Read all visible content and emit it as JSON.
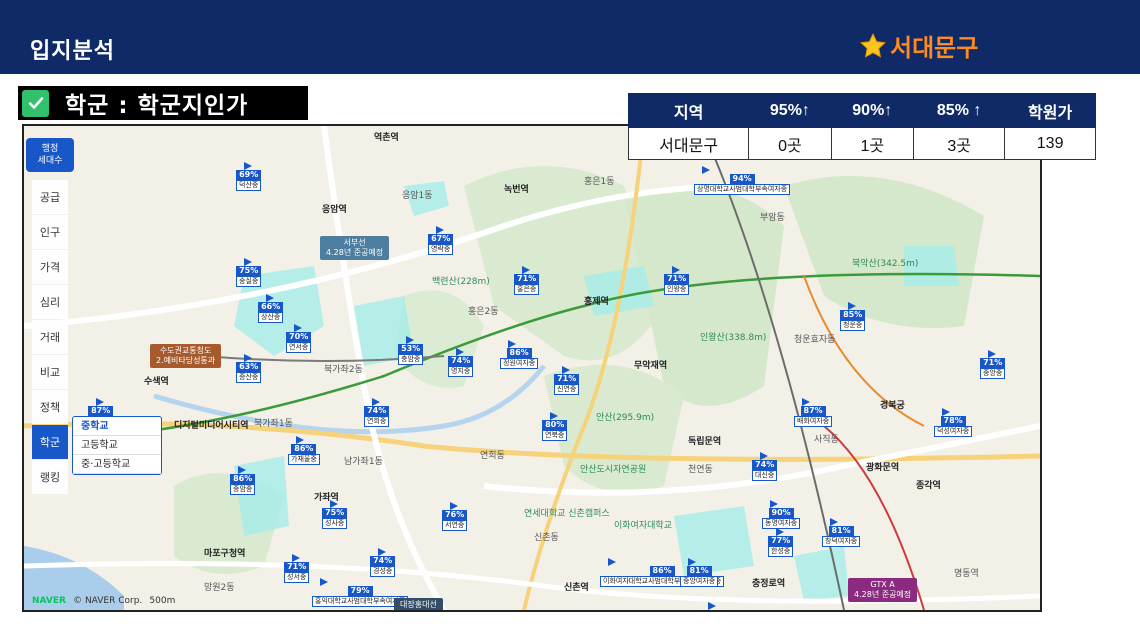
{
  "header": {
    "title": "입지분석",
    "region": "서대문구"
  },
  "section": {
    "label": "학군 : 학군지인가"
  },
  "table": {
    "headers": [
      "지역",
      "95%↑",
      "90%↑",
      "85% ↑",
      "학원가"
    ],
    "row": [
      "서대문구",
      "0곳",
      "1곳",
      "3곳",
      "139"
    ]
  },
  "side_nav": {
    "top_line1": "행정",
    "top_line2": "세대수",
    "items": [
      "공급",
      "인구",
      "가격",
      "심리",
      "거래",
      "비교",
      "정책",
      "학군",
      "랭킹"
    ],
    "active": "학군"
  },
  "school_popup": [
    "중학교",
    "고등학교",
    "중·고등학교"
  ],
  "markers": [
    {
      "pct": "69%",
      "name": "덕산중"
    },
    {
      "pct": "75%",
      "name": "숭실중"
    },
    {
      "pct": "66%",
      "name": "상산중"
    },
    {
      "pct": "70%",
      "name": "연서중"
    },
    {
      "pct": "63%",
      "name": "증산중"
    },
    {
      "pct": "87%",
      "name": "상암중"
    },
    {
      "pct": "67%",
      "name": "영락중"
    },
    {
      "pct": "53%",
      "name": "충암중"
    },
    {
      "pct": "74%",
      "name": "명지중"
    },
    {
      "pct": "86%",
      "name": "정원여자중"
    },
    {
      "pct": "71%",
      "name": "홍은중"
    },
    {
      "pct": "71%",
      "name": "신연중"
    },
    {
      "pct": "71%",
      "name": "인왕중"
    },
    {
      "pct": "94%",
      "name": "상명대학교사범대학부속여자중"
    },
    {
      "pct": "85%",
      "name": "청운중"
    },
    {
      "pct": "71%",
      "name": "중앙중"
    },
    {
      "pct": "74%",
      "name": "연희중"
    },
    {
      "pct": "80%",
      "name": "연북중"
    },
    {
      "pct": "87%",
      "name": "배화여자중"
    },
    {
      "pct": "78%",
      "name": "덕성여자중"
    },
    {
      "pct": "86%",
      "name": "가재울중"
    },
    {
      "pct": "86%",
      "name": "중암중"
    },
    {
      "pct": "74%",
      "name": "대신중"
    },
    {
      "pct": "75%",
      "name": "성사중"
    },
    {
      "pct": "76%",
      "name": "서연중"
    },
    {
      "pct": "90%",
      "name": "동명여자중"
    },
    {
      "pct": "77%",
      "name": "한성중"
    },
    {
      "pct": "81%",
      "name": "창덕여자중"
    },
    {
      "pct": "71%",
      "name": "성서중"
    },
    {
      "pct": "79%",
      "name": "홍익대학교사범대학부속여자중"
    },
    {
      "pct": "74%",
      "name": "경성중"
    },
    {
      "pct": "86%",
      "name": "이화여자대학교사범대학부속이화·금란중"
    },
    {
      "pct": "81%",
      "name": "중앙여자중"
    },
    {
      "pct": "74%",
      "name": "경신중"
    }
  ],
  "places": [
    "역촌역",
    "응암역",
    "응암1동",
    "홍은1동",
    "녹번역",
    "부암동",
    "홍제역",
    "무악재역",
    "홍은2동",
    "북가좌2동",
    "수색역",
    "디지털미디어시티역",
    "북가좌1동",
    "남가좌1동",
    "연희동",
    "신촌동",
    "천연동",
    "독립문역",
    "사직동",
    "경복궁",
    "광화문역",
    "종각역",
    "가좌역",
    "마포구청역",
    "망원2동",
    "신촌역",
    "충정로역",
    "청운효자동",
    "명동역",
    "안산(295.9m)",
    "인왕산(338.8m)",
    "백련산(228m)",
    "북악산(342.5m)",
    "안산도시자연공원",
    "연세대학교 신촌캠퍼스",
    "이화여자대학교"
  ],
  "line_tags": {
    "seobu": "서부선\n4.28년 준공예정",
    "gwangyeok": "수도권교통청도\n2.예비타당성통과",
    "daejang": "대장홍대선",
    "gtx": "GTX A\n4.28년 준공예정"
  },
  "map_footer": {
    "brand": "NAVER",
    "copy": "© NAVER Corp.",
    "scale": "500m"
  },
  "colors": {
    "header_bg": "#0f2a66",
    "accent_orange": "#ff8a1f",
    "marker_blue": "#1757c8",
    "check_green": "#31c06b"
  }
}
